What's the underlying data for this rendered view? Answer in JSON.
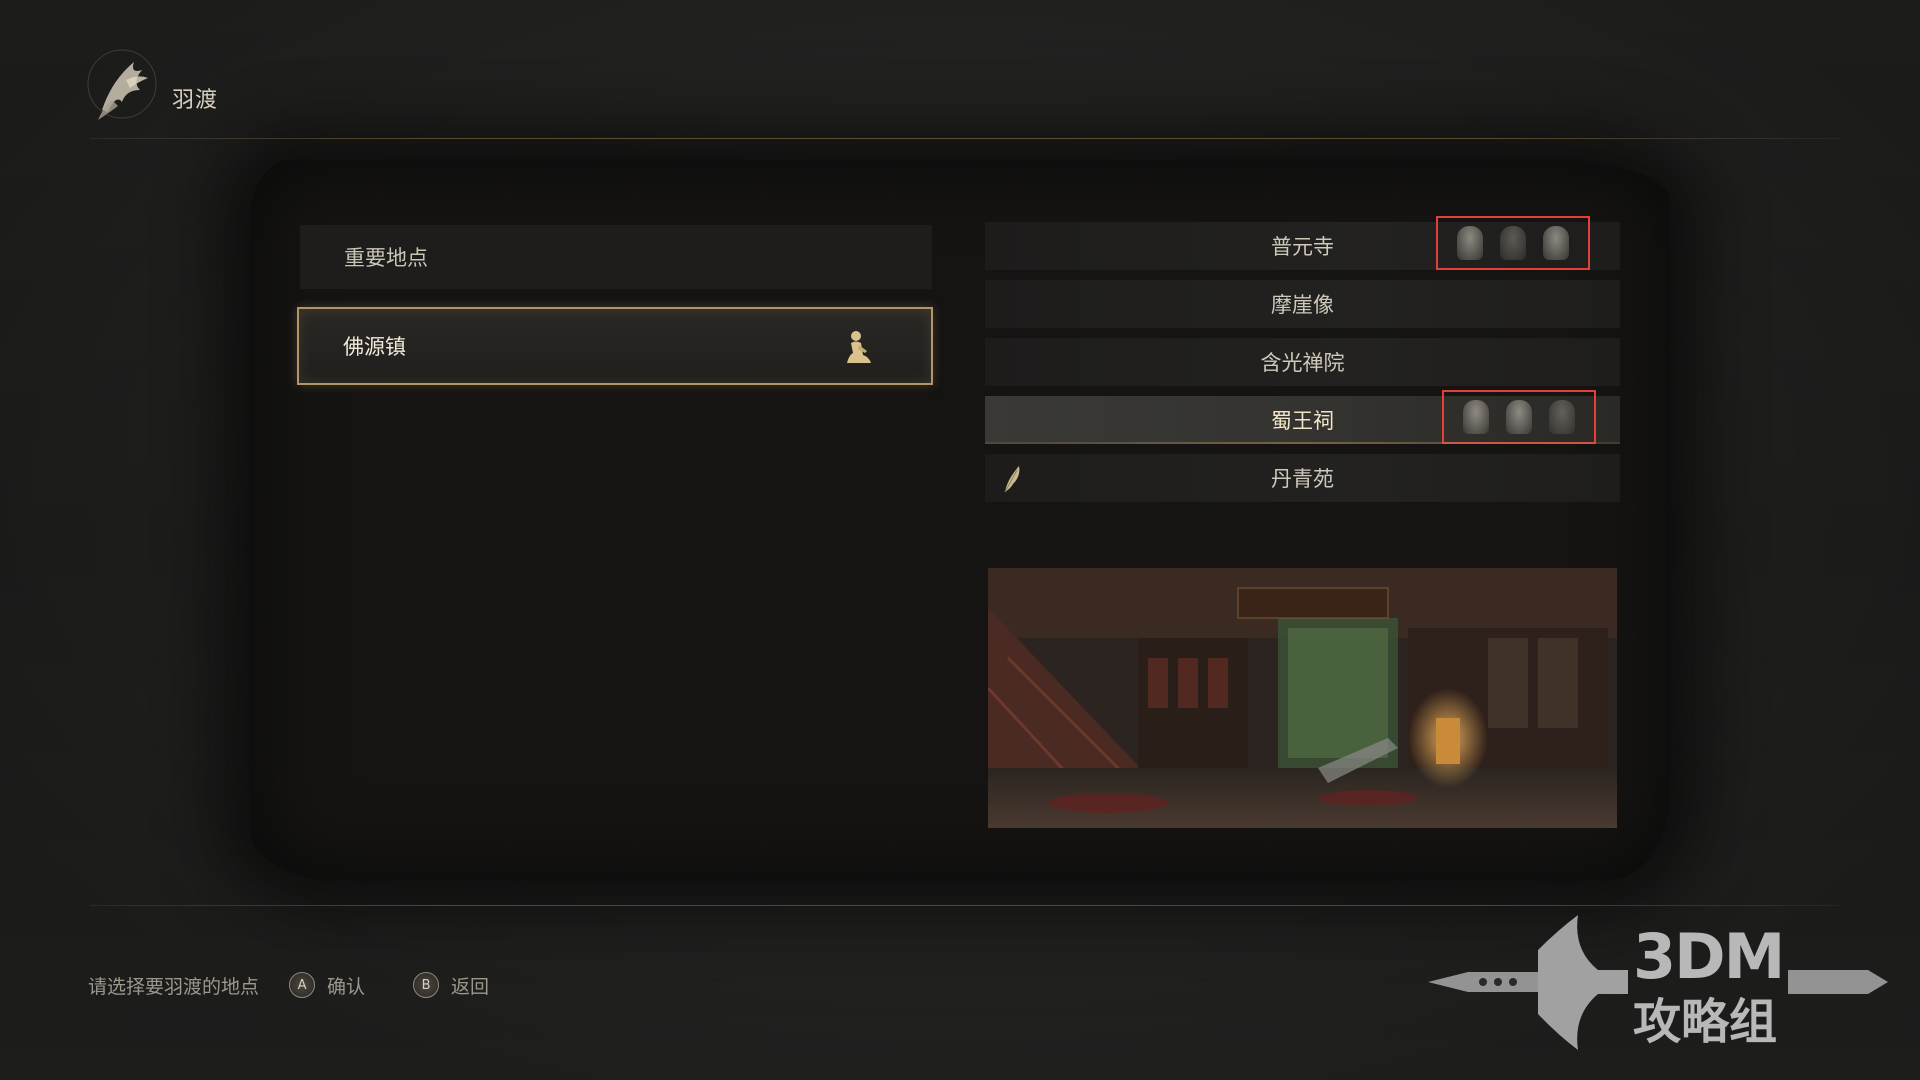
{
  "header": {
    "title": "羽渡",
    "logo_icon": "phoenix-emblem-icon"
  },
  "left_list": {
    "items": [
      {
        "label": "重要地点",
        "selected": false
      },
      {
        "label": "佛源镇",
        "selected": true,
        "icon": "kneeling-figure-icon"
      }
    ]
  },
  "right_list": {
    "items": [
      {
        "label": "普元寺",
        "has_portraits": true,
        "highlight": false
      },
      {
        "label": "摩崖像",
        "has_portraits": false,
        "highlight": false
      },
      {
        "label": "含光禅院",
        "has_portraits": false,
        "highlight": false
      },
      {
        "label": "蜀王祠",
        "has_portraits": true,
        "highlight": true
      },
      {
        "label": "丹青苑",
        "has_portraits": false,
        "highlight": false,
        "icon": "feather-icon"
      }
    ]
  },
  "preview": {
    "icon": "location-preview-image"
  },
  "footer": {
    "hint": "请选择要羽渡的地点",
    "confirm_glyph": "A",
    "confirm_label": "确认",
    "back_glyph": "B",
    "back_label": "返回"
  },
  "watermark": {
    "line1": "3DM",
    "line2": "攻略组"
  },
  "colors": {
    "accent_gold": "#b39667",
    "annotation_red": "#e0423a",
    "panel_dark": "#151413"
  }
}
